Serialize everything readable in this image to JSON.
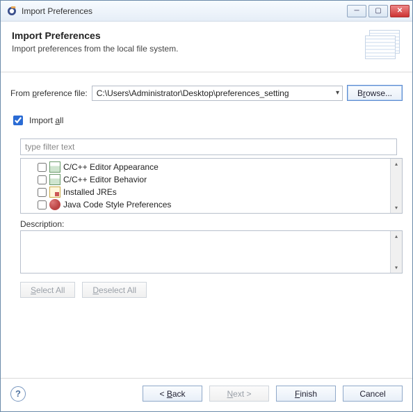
{
  "window": {
    "title": "Import Preferences"
  },
  "header": {
    "heading": "Import Preferences",
    "subheading": "Import preferences from the local file system."
  },
  "fileRow": {
    "label": "From preference file:",
    "value": "C:\\Users\\Administrator\\Desktop\\preferences_setting",
    "browse": "Browse..."
  },
  "importAll": {
    "label": "Import all",
    "checked": true
  },
  "filter": {
    "placeholder": "type filter text"
  },
  "tree": {
    "items": [
      {
        "label": "C/C++ Editor Appearance",
        "icon": "sheet"
      },
      {
        "label": "C/C++ Editor Behavior",
        "icon": "sheet"
      },
      {
        "label": "Installed JREs",
        "icon": "tools"
      },
      {
        "label": "Java Code Style Preferences",
        "icon": "java"
      }
    ]
  },
  "description": {
    "label": "Description:"
  },
  "selectButtons": {
    "selectAll": "Select All",
    "deselectAll": "Deselect All"
  },
  "footer": {
    "back": "< Back",
    "next": "Next >",
    "finish": "Finish",
    "cancel": "Cancel"
  }
}
